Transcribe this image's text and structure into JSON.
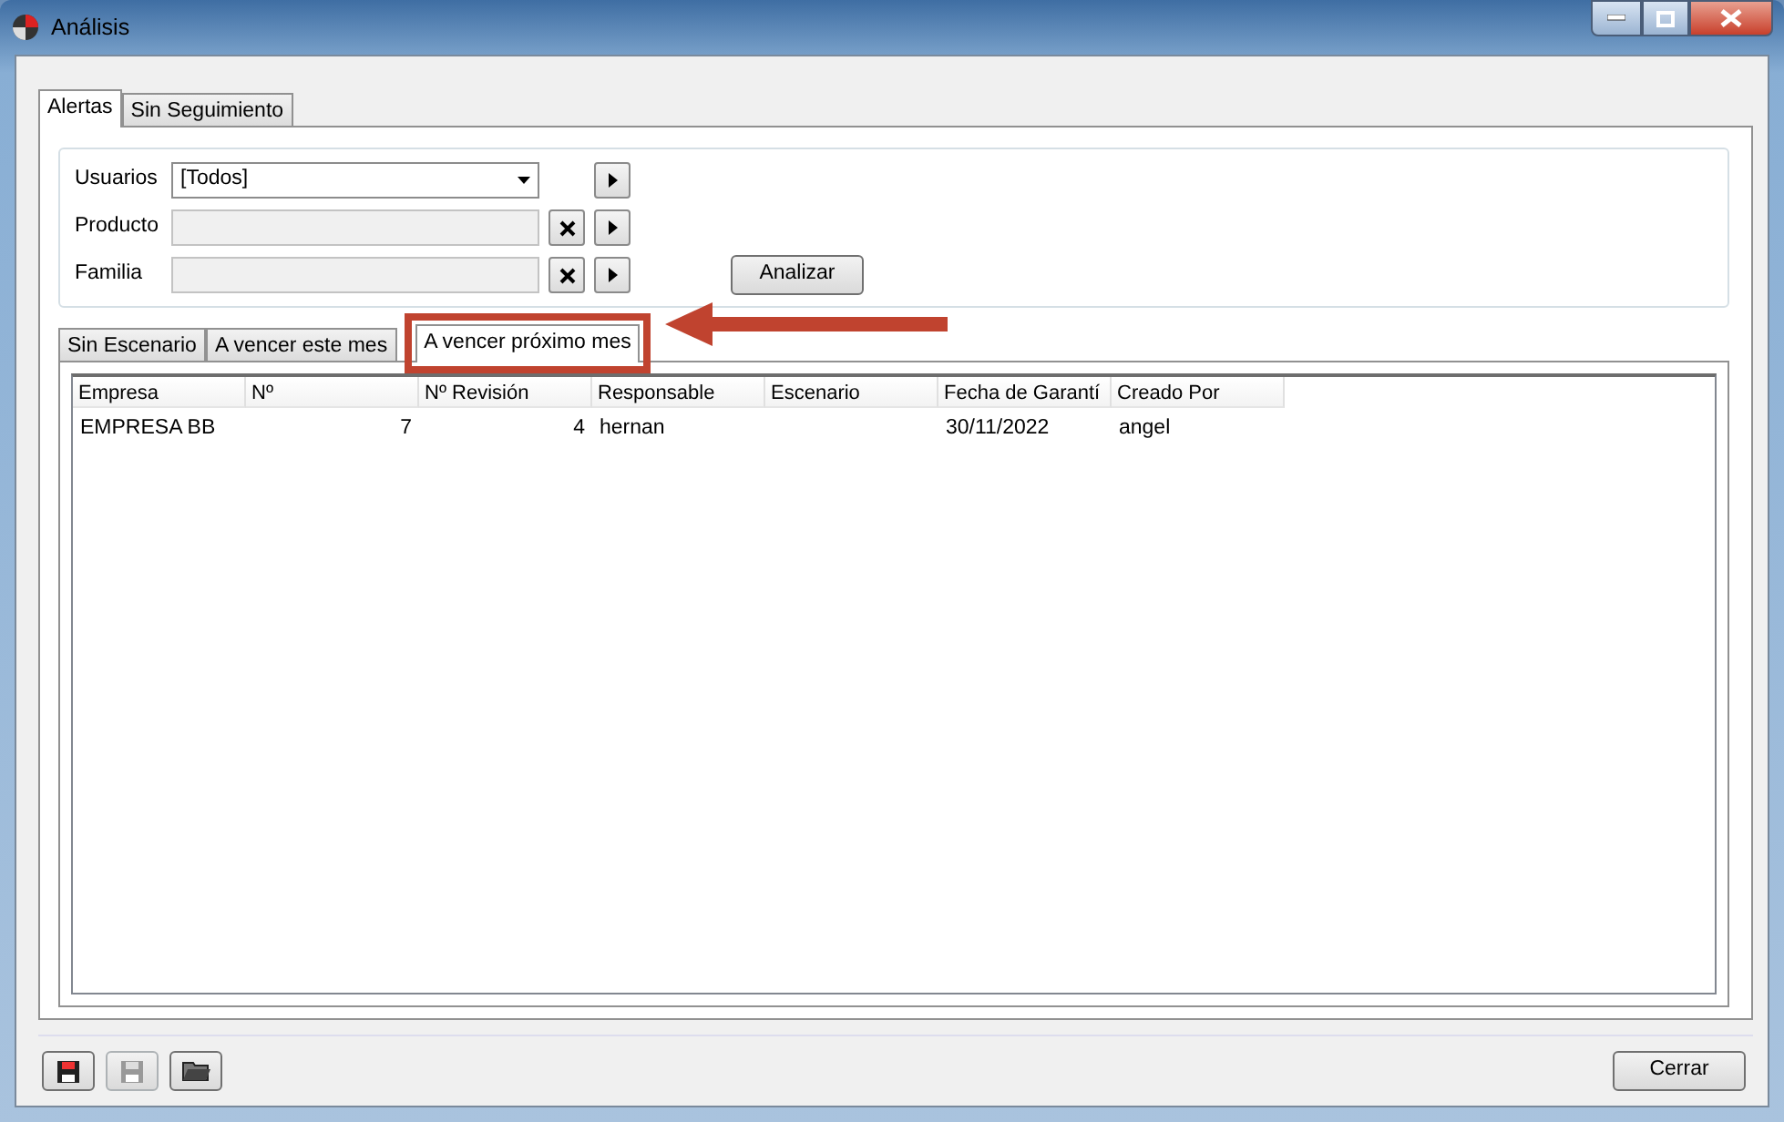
{
  "window": {
    "title": "Análisis"
  },
  "tabs": [
    {
      "label": "Alertas",
      "selected": true
    },
    {
      "label": "Sin Seguimiento",
      "selected": false
    }
  ],
  "filters": [
    {
      "label": "Usuarios",
      "kind": "dropdown",
      "value": "[Todos]"
    },
    {
      "label": "Producto",
      "kind": "lookup"
    },
    {
      "label": "Familia",
      "kind": "lookup"
    }
  ],
  "analyze_button": "Analizar",
  "result_tabs": [
    {
      "label": "Sin Escenario",
      "selected": false,
      "highlighted": false
    },
    {
      "label": "A vencer este mes",
      "selected": false,
      "highlighted": false
    },
    {
      "label": "A vencer próximo mes",
      "selected": true,
      "highlighted": true
    }
  ],
  "annotation_arrow": true,
  "table": {
    "columns": [
      {
        "label": "Empresa",
        "kind": "text"
      },
      {
        "label": "Nº",
        "kind": "number"
      },
      {
        "label": "Nº Revisión",
        "kind": "number"
      },
      {
        "label": "Responsable",
        "kind": "text"
      },
      {
        "label": "Escenario",
        "kind": "text"
      },
      {
        "label": "Fecha de Garantí",
        "kind": "text"
      },
      {
        "label": "Creado Por",
        "kind": "text"
      }
    ],
    "rows": [
      [
        "EMPRESA BB",
        "7",
        "4",
        "hernan",
        "",
        "30/11/2022",
        "angel"
      ]
    ]
  },
  "footer_buttons": [
    {
      "kind": "save",
      "disabled": false
    },
    {
      "kind": "save",
      "disabled": true
    },
    {
      "kind": "open",
      "disabled": false
    }
  ],
  "close_button": "Cerrar"
}
